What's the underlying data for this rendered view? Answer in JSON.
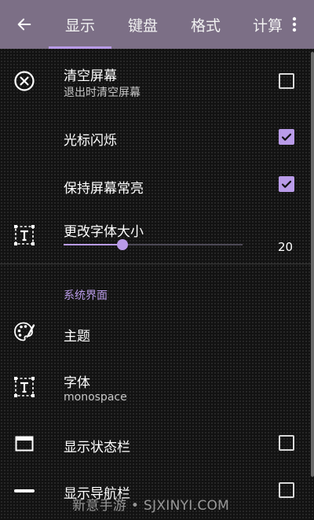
{
  "app_bar": {
    "back_icon": "arrow-left-icon",
    "overflow_icon": "more-vertical-icon",
    "tabs": [
      {
        "label": "显示",
        "selected": true
      },
      {
        "label": "键盘",
        "selected": false
      },
      {
        "label": "格式",
        "selected": false
      },
      {
        "label": "计算",
        "selected": false
      }
    ]
  },
  "settings": {
    "clear_screen": {
      "title": "清空屏幕",
      "subtitle": "退出时清空屏幕",
      "checked": false,
      "icon": "clear-circle-icon"
    },
    "cursor_blink": {
      "title": "光标闪烁",
      "checked": true
    },
    "keep_screen_on": {
      "title": "保持屏幕常亮",
      "checked": true
    },
    "font_size": {
      "title": "更改字体大小",
      "value": "20",
      "slider_fraction": 0.33,
      "icon": "text-resize-icon"
    }
  },
  "system_ui": {
    "header": "系统界面",
    "theme": {
      "title": "主题",
      "icon": "palette-icon"
    },
    "font": {
      "title": "字体",
      "subtitle": "monospace",
      "icon": "text-resize-icon"
    },
    "show_status_bar": {
      "title": "显示状态栏",
      "checked": false,
      "icon": "window-icon"
    },
    "show_nav_bar": {
      "title": "显示导航栏",
      "checked": false,
      "icon": "minus-bar-icon"
    }
  },
  "watermark": "新意手游 • SJXINYI.COM",
  "colors": {
    "accent": "#b99be8",
    "app_bar": "#7c6f86",
    "background": "#121212"
  }
}
